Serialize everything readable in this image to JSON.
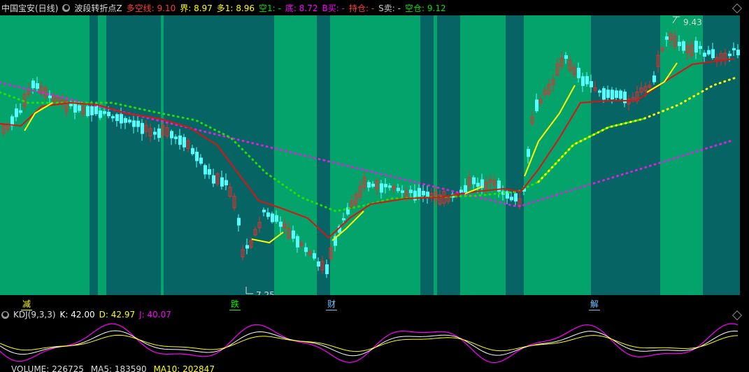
{
  "header": {
    "stock_name": "中国宝安(日线)",
    "indicator_name": "波段转折点Z",
    "fields": [
      {
        "label": "多空线:",
        "value": "9.10",
        "color": "#ff3b3b"
      },
      {
        "label": "界:",
        "value": "8.97",
        "color": "#ffff00"
      },
      {
        "label": "多1:",
        "value": "8.96",
        "color": "#ffff00"
      },
      {
        "label": "空1:",
        "value": "-",
        "color": "#00e000"
      },
      {
        "label": "底:",
        "value": "8.72",
        "color": "#ff00ff"
      },
      {
        "label": "B买:",
        "value": "-",
        "color": "#ff00ff"
      },
      {
        "label": "持仓:",
        "value": "-",
        "color": "#ff3b3b"
      },
      {
        "label": "S卖:",
        "value": "-",
        "color": "#c8c8c8"
      },
      {
        "label": "空仓:",
        "value": "9.12",
        "color": "#00e000"
      }
    ]
  },
  "price_annotations": {
    "high": "9.43",
    "low": "7.25"
  },
  "events": [
    {
      "label": "减",
      "color": "#ffff00"
    },
    {
      "label": "跌",
      "color": "#00ff00"
    },
    {
      "label": "财",
      "color": "#6fc3ff"
    },
    {
      "label": "解",
      "color": "#6fc3ff"
    }
  ],
  "kdj": {
    "name": "KDJ(9,3,3)",
    "k_label": "K: 42.00",
    "d_label": "D: 42.97",
    "j_label": "J: 40.07"
  },
  "volume": {
    "label": "VOLUME: 226725",
    "ma5": "MA5: 183590",
    "ma10": "MA10: 202847"
  },
  "colors": {
    "bg_light": "#04a36b",
    "bg_dark": "#066464",
    "up": "#e03030",
    "down": "#55ffff",
    "ma_red": "#d81414",
    "line_yellow": "#ffff00",
    "dot_green": "#22e000",
    "dot_magenta": "#dd22dd",
    "k_color": "#ffffff",
    "d_color": "#ffff00",
    "j_color": "#ff00ff"
  }
}
